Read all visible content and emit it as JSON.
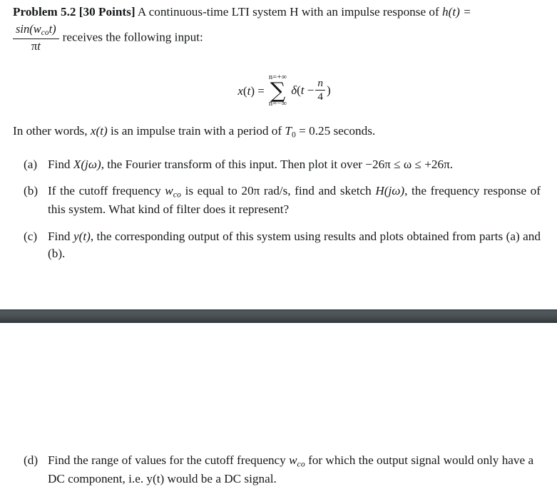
{
  "document": {
    "background_color": "#ffffff",
    "text_color": "#16181a",
    "separator_band_color": "#4b5256"
  },
  "problem": {
    "heading_bold": "Problem 5.2  [30 Points]",
    "intro_part1": " A continuous-time LTI system H with an impulse response of ",
    "impulse_response_inline": "h(t) =",
    "impulse_response_numerator": "sin(w",
    "impulse_response_num_sub": "co",
    "impulse_response_num_tail": "t)",
    "impulse_response_denominator_pi": "π",
    "impulse_response_denominator_t": "t",
    "intro_part2": "receives the following input:"
  },
  "equation": {
    "lhs_x": "x",
    "lhs_paren_open": "(",
    "lhs_t": "t",
    "lhs_paren_close": ")",
    "equals": "=",
    "sum_upper_limit": "n=+∞",
    "sigma": "∑",
    "sum_lower_limit": "n=−∞",
    "delta": "δ",
    "delta_open": "(",
    "delta_t": "t",
    "minus": "−",
    "frac_numerator": "n",
    "frac_denominator": "4",
    "delta_close": ")"
  },
  "paragraph": {
    "text_before": "In other words, ",
    "x_of_t": "x(t)",
    "text_middle": " is an impulse train with a period of ",
    "T_symbol": "T",
    "T_subscript": "0",
    "equals_value": " = 0.25 seconds.",
    "full_text": "In other words, x(t) is an impulse train with a period of T0 = 0.25 seconds."
  },
  "list": {
    "items": [
      {
        "marker": "(a)",
        "name": "item-a",
        "text": "Find X(jω), the Fourier transform of this input. Then plot it over −26π ≤ ω ≤ +26π.",
        "segments": {
          "s1": "Find ",
          "math1_X": "X",
          "math1_arg": "(jω)",
          "s2": ", the Fourier transform of this input. Then plot it over ",
          "range": "−26π ≤ ω ≤ +26π."
        }
      },
      {
        "marker": "(b)",
        "name": "item-b",
        "text": "If the cutoff frequency wco is equal to 20π rad/s, find and sketch H(jω), the frequency response of this system. What kind of filter does it represent?",
        "segments": {
          "s1": "If the cutoff frequency ",
          "w_symbol": "w",
          "w_sub": "co",
          "s2": " is equal to 20π rad/s, find and sketch ",
          "H_symbol": "H",
          "H_arg": "(jω)",
          "s3": ", the frequency response of this system. What kind of filter does it represent?"
        }
      },
      {
        "marker": "(c)",
        "name": "item-c",
        "text": "Find y(t), the corresponding output of this system using results and plots obtained from parts (a) and (b).",
        "segments": {
          "s1": "Find ",
          "y_of_t": "y(t)",
          "s2": ", the corresponding output of this system using results and plots obtained from parts (a) and (b)."
        }
      }
    ],
    "item_d": {
      "marker": "(d)",
      "name": "item-d",
      "text": "Find the range of values for the cutoff frequency wco for which the output signal would only have a DC component, i.e. y(t) would be a DC signal.",
      "segments": {
        "s1": "Find the range of values for the cutoff frequency ",
        "w_symbol": "w",
        "w_sub": "co",
        "s2": " for which the output signal would",
        "line2": "only have a DC component, i.e. y(t) would be a DC signal."
      }
    }
  }
}
